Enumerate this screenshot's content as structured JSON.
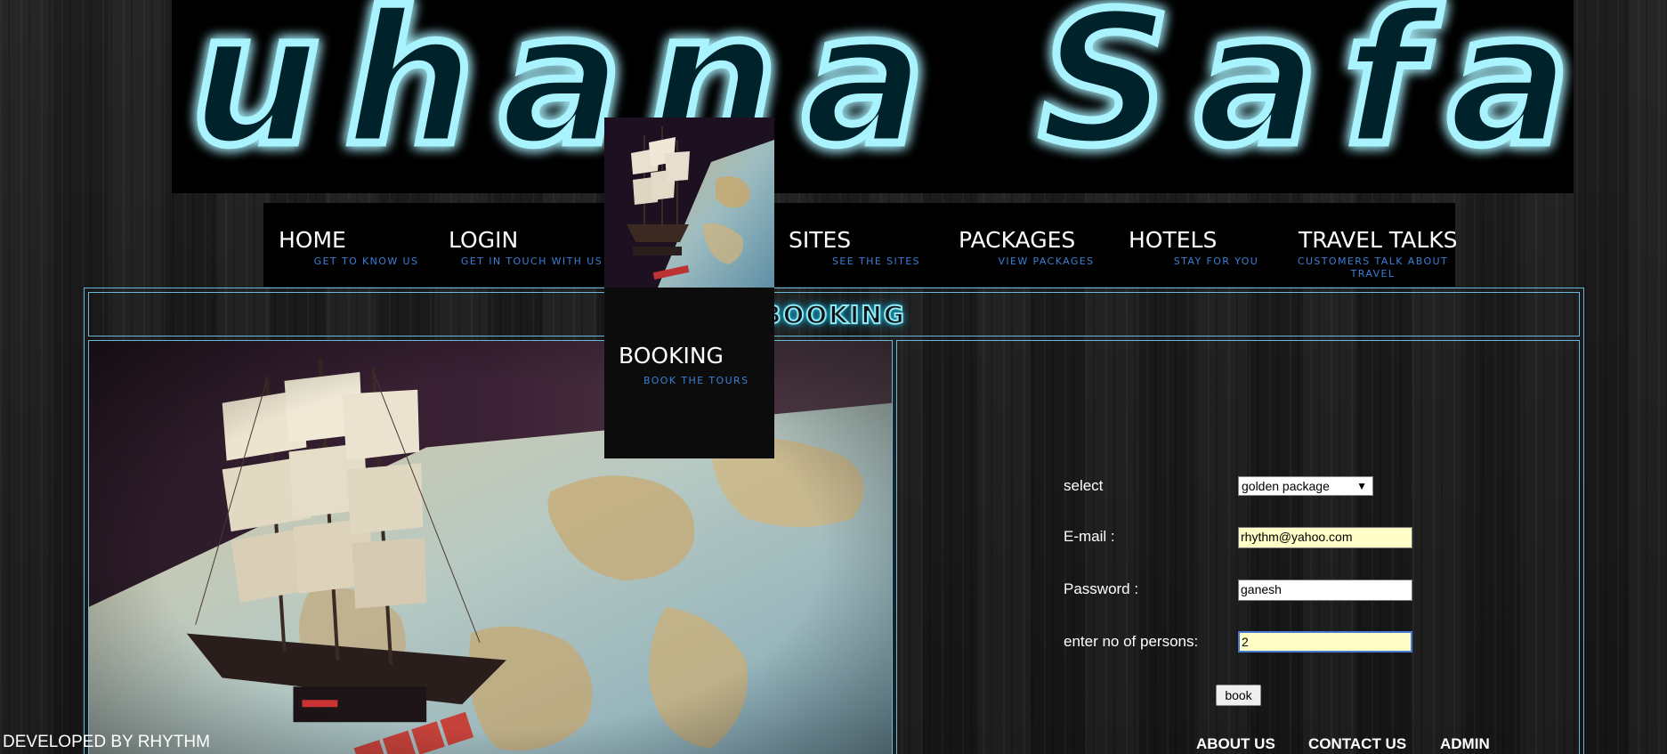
{
  "banner": {
    "logo_text": "Suhana Safar"
  },
  "nav": {
    "items": [
      {
        "label": "HOME",
        "sub": "GET TO KNOW US"
      },
      {
        "label": "LOGIN",
        "sub": "GET IN TOUCH WITH US"
      },
      {
        "label": "BOOKING",
        "sub": "BOOK THE TOURS"
      },
      {
        "label": "SITES",
        "sub": "SEE THE SITES"
      },
      {
        "label": "PACKAGES",
        "sub": "VIEW PACKAGES"
      },
      {
        "label": "HOTELS",
        "sub": "STAY FOR YOU"
      },
      {
        "label": "TRAVEL TALKS",
        "sub": "CUSTOMERS TALK ABOUT TRAVEL"
      }
    ]
  },
  "main": {
    "title": "BOOKING"
  },
  "form": {
    "select_label": "select",
    "select_value": "golden package",
    "email_label": "E-mail :",
    "email_value": "rhythm@yahoo.com",
    "password_label": "Password :",
    "password_value": "ganesh",
    "persons_label": "enter no of persons:",
    "persons_value": "2",
    "submit_label": "book"
  },
  "footer": {
    "credit": "DEVELOPED BY RHYTHM",
    "links": [
      "ABOUT US",
      "CONTACT US",
      "ADMIN"
    ]
  },
  "colors": {
    "neon": "#21c4e6",
    "nav_sub": "#3a7fd6",
    "frame_border": "#6ab8d8",
    "input_highlight": "#fefec6"
  }
}
